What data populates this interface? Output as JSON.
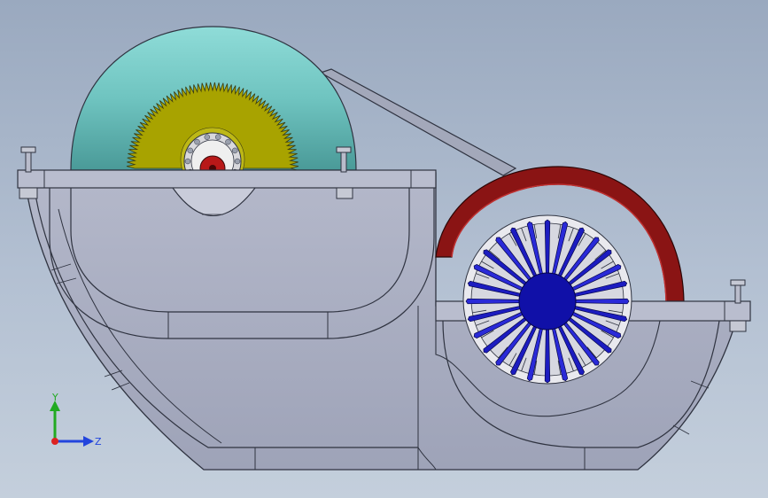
{
  "colors": {
    "background_top": "#9aa9bf",
    "background_bottom": "#c4cfdc",
    "housing": "#aab0c4",
    "housing_edge": "#2f3340",
    "pulley_large": "#6fc4c0",
    "spur_gear": "#a8a300",
    "pulley_small": "#8a1414",
    "bevel_gear": "#1a1ab8",
    "shaft": "#b81818",
    "belt": "#9ea3b4",
    "axis_y": "#22aa22",
    "axis_z": "#2244dd",
    "axis_origin": "#dd2222"
  },
  "parts": [
    {
      "id": "large-pulley",
      "icon": "pulley-icon"
    },
    {
      "id": "spur-gear",
      "icon": "spur-gear-icon"
    },
    {
      "id": "small-pulley",
      "icon": "pulley-icon"
    },
    {
      "id": "bevel-gear",
      "icon": "bevel-gear-icon"
    },
    {
      "id": "drive-belt",
      "icon": "belt-icon"
    },
    {
      "id": "housing",
      "icon": "housing-icon"
    }
  ],
  "triad": {
    "y_label": "Y",
    "z_label": "Z"
  }
}
